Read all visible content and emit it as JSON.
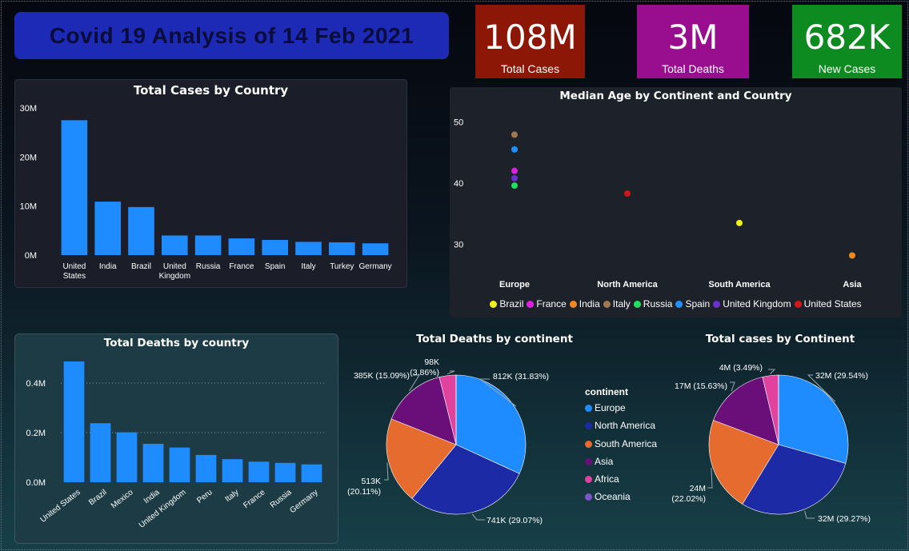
{
  "header": {
    "title": "Covid 19 Analysis of 14 Feb 2021"
  },
  "kpis": {
    "total_cases": {
      "value": "108M",
      "label": "Total Cases",
      "color": "#8c1707"
    },
    "total_deaths": {
      "value": "3M",
      "label": "Total Deaths",
      "color": "#990e8e"
    },
    "new_cases": {
      "value": "682K",
      "label": "New Cases",
      "color": "#0d8b20"
    }
  },
  "colors": {
    "bar": "#1e8cff",
    "Europe": "#1e8cff",
    "North America": "#1d2aa6",
    "South America": "#e56b2e",
    "Asia": "#6a0f7a",
    "Africa": "#e0439e",
    "Oceania": "#7b55c9",
    "Brazil": "#f0f020",
    "France": "#e020e0",
    "India": "#f08a20",
    "Italy": "#a07850",
    "Russia": "#20e060",
    "Spain": "#2090ff",
    "United Kingdom": "#6a30d0",
    "United States": "#d01818"
  },
  "chart_data": [
    {
      "id": "cases_by_country",
      "type": "bar",
      "title": "Total Cases by Country",
      "categories": [
        "United States",
        "India",
        "Brazil",
        "United Kingdom",
        "Russia",
        "France",
        "Spain",
        "Italy",
        "Turkey",
        "Germany"
      ],
      "values": [
        27.5,
        10.9,
        9.8,
        4.0,
        4.0,
        3.4,
        3.1,
        2.7,
        2.6,
        2.4
      ],
      "ylim": [
        0,
        30
      ],
      "yticks": [
        "0M",
        "10M",
        "20M",
        "30M"
      ],
      "ytick_values": [
        0,
        10,
        20,
        30
      ],
      "units": "millions",
      "grid": false
    },
    {
      "id": "median_age",
      "type": "scatter",
      "title": "Median Age by Continent and Country",
      "categories": [
        "Europe",
        "North America",
        "South America",
        "Asia"
      ],
      "ylim": [
        25,
        52
      ],
      "yticks": [
        "30",
        "40",
        "50"
      ],
      "ytick_values": [
        30,
        40,
        50
      ],
      "legend": [
        "Brazil",
        "France",
        "India",
        "Italy",
        "Russia",
        "Spain",
        "United Kingdom",
        "United States"
      ],
      "legend_position": "bottom",
      "points": [
        {
          "series": "Italy",
          "x": "Europe",
          "y": 47.9
        },
        {
          "series": "Spain",
          "x": "Europe",
          "y": 45.5
        },
        {
          "series": "France",
          "x": "Europe",
          "y": 42.0
        },
        {
          "series": "United Kingdom",
          "x": "Europe",
          "y": 40.8
        },
        {
          "series": "Russia",
          "x": "Europe",
          "y": 39.6
        },
        {
          "series": "United States",
          "x": "North America",
          "y": 38.3
        },
        {
          "series": "Brazil",
          "x": "South America",
          "y": 33.5
        },
        {
          "series": "India",
          "x": "Asia",
          "y": 28.2
        }
      ]
    },
    {
      "id": "deaths_by_country",
      "type": "bar",
      "title": "Total Deaths by country",
      "categories": [
        "United States",
        "Brazil",
        "Mexico",
        "India",
        "United Kingdom",
        "Peru",
        "Italy",
        "France",
        "Russia",
        "Germany"
      ],
      "values": [
        0.487,
        0.238,
        0.201,
        0.155,
        0.14,
        0.11,
        0.093,
        0.083,
        0.078,
        0.072
      ],
      "ylim": [
        0,
        0.5
      ],
      "yticks": [
        "0.0M",
        "0.2M",
        "0.4M"
      ],
      "ytick_values": [
        0,
        0.2,
        0.4
      ],
      "units": "millions",
      "grid": true
    },
    {
      "id": "deaths_by_continent",
      "type": "pie",
      "title": "Total Deaths by continent",
      "slices": [
        {
          "name": "Europe",
          "value": 812,
          "percent": 31.83,
          "label": "812K (31.83%)"
        },
        {
          "name": "North America",
          "value": 741,
          "percent": 29.07,
          "label": "741K (29.07%)"
        },
        {
          "name": "South America",
          "value": 513,
          "percent": 20.11,
          "label": "513K\n(20.11%)"
        },
        {
          "name": "Asia",
          "value": 385,
          "percent": 15.09,
          "label": "385K (15.09%)"
        },
        {
          "name": "Africa",
          "value": 98,
          "percent": 3.86,
          "label": "98K\n(3.86%)"
        },
        {
          "name": "Oceania",
          "value": 1,
          "percent": 0.04,
          "label": ""
        }
      ]
    },
    {
      "id": "cases_by_continent",
      "type": "pie",
      "title": "Total cases by Continent",
      "slices": [
        {
          "name": "Europe",
          "value": 32,
          "percent": 29.54,
          "label": "32M (29.54%)"
        },
        {
          "name": "North America",
          "value": 32,
          "percent": 29.27,
          "label": "32M (29.27%)"
        },
        {
          "name": "South America",
          "value": 24,
          "percent": 22.02,
          "label": "24M\n(22.02%)"
        },
        {
          "name": "Asia",
          "value": 17,
          "percent": 15.63,
          "label": "17M (15.63%)"
        },
        {
          "name": "Africa",
          "value": 4,
          "percent": 3.49,
          "label": "4M (3.49%)"
        },
        {
          "name": "Oceania",
          "value": 0.05,
          "percent": 0.05,
          "label": ""
        }
      ]
    }
  ],
  "continent_legend": {
    "title": "continent",
    "items": [
      "Europe",
      "North America",
      "South America",
      "Asia",
      "Africa",
      "Oceania"
    ]
  }
}
